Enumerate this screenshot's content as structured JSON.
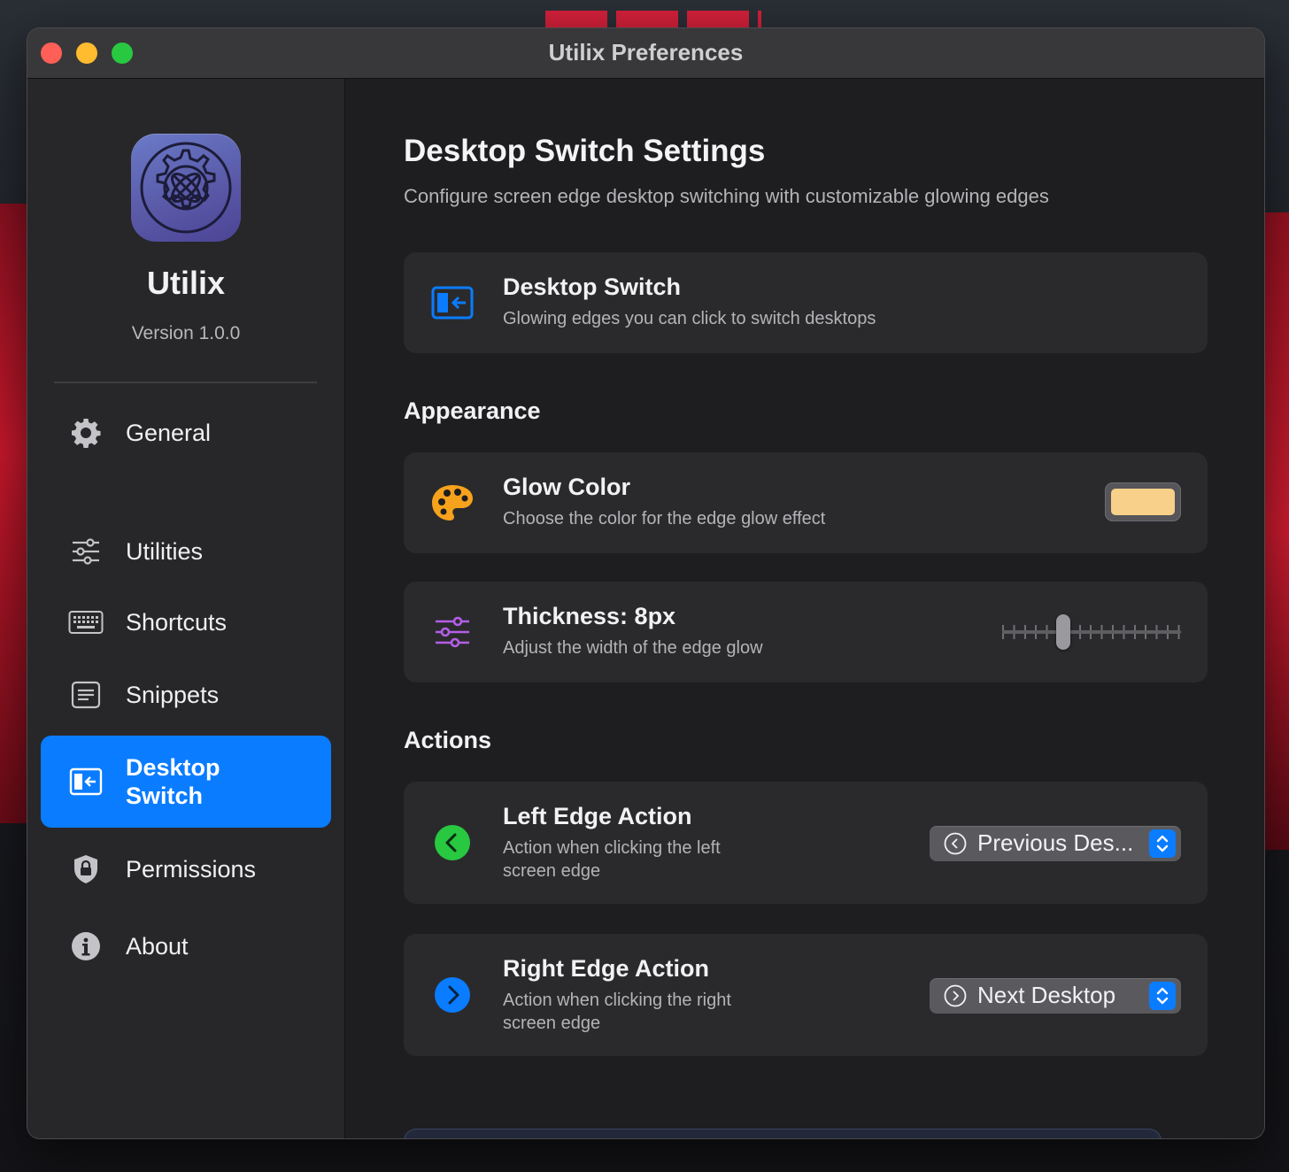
{
  "window": {
    "title": "Utilix Preferences"
  },
  "sidebar": {
    "app_name": "Utilix",
    "version": "Version 1.0.0",
    "items": [
      {
        "label": "General",
        "icon": "gear-icon"
      },
      {
        "label": "Utilities",
        "icon": "sliders-icon"
      },
      {
        "label": "Shortcuts",
        "icon": "keyboard-icon"
      },
      {
        "label": "Snippets",
        "icon": "document-icon"
      },
      {
        "label": "Desktop Switch",
        "label_line1": "Desktop",
        "label_line2": "Switch",
        "icon": "desktop-switch-icon",
        "active": true
      },
      {
        "label": "Permissions",
        "icon": "lock-shield-icon"
      },
      {
        "label": "About",
        "icon": "info-icon"
      }
    ]
  },
  "main": {
    "title": "Desktop Switch Settings",
    "subtitle": "Configure screen edge desktop switching with customizable glowing edges",
    "feature_card": {
      "title": "Desktop Switch",
      "description": "Glowing edges you can click to switch desktops"
    },
    "appearance": {
      "section_title": "Appearance",
      "glow_color": {
        "title": "Glow Color",
        "description": "Choose the color for the edge glow effect",
        "value": "#f8d08a"
      },
      "thickness": {
        "title": "Thickness: 8px",
        "description": "Adjust the width of the edge glow",
        "value": 8,
        "min": 1,
        "max": 30
      }
    },
    "actions": {
      "section_title": "Actions",
      "left_edge": {
        "title": "Left Edge Action",
        "description": "Action when clicking the left screen edge",
        "selected": "Previous Des..."
      },
      "right_edge": {
        "title": "Right Edge Action",
        "description": "Action when clicking the right screen edge",
        "selected": "Next Desktop"
      }
    }
  },
  "colors": {
    "accent": "#0a7cff",
    "left_action": "#28c840",
    "right_action": "#0a7cff",
    "palette_icon": "#f6a21c",
    "sliders_icon": "#b45ee6"
  }
}
